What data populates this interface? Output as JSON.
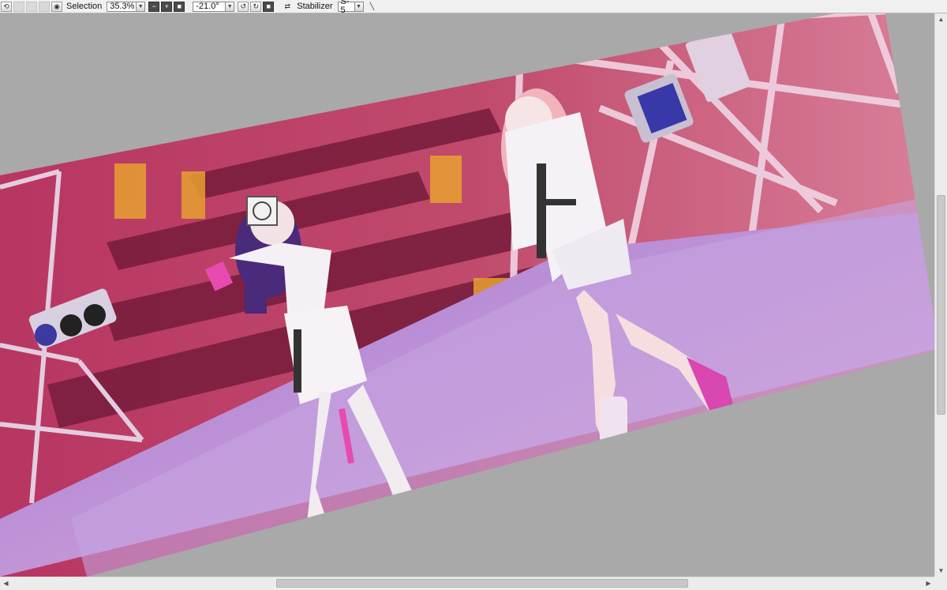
{
  "toolbar": {
    "selection_label": "Selection",
    "zoom_value": "35.3%",
    "rotation_value": "-21.0°",
    "stabilizer_label": "Stabilizer",
    "stabilizer_value": "S-5",
    "icons": [
      "rotate-reset-icon",
      "undo-icon",
      "redo-icon",
      "eye-icon",
      "zoom-out-icon",
      "zoom-in-icon",
      "fit-icon",
      "rotate-left-icon",
      "rotate-right-icon",
      "reset-rotation-icon",
      "flip-icon",
      "pen-icon"
    ]
  },
  "canvas": {
    "background_color": "#a9a9a9",
    "image_colors": {
      "backdrop": "#b43a62",
      "floor": "#c8a0d8",
      "truss": "#e8c8dc"
    }
  },
  "scroll": {
    "vertical_position": 0.38,
    "horizontal_position": 0.45
  }
}
